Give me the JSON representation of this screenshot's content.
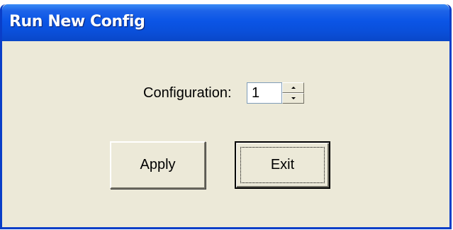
{
  "window": {
    "title": "Run New Config"
  },
  "form": {
    "configuration_label": "Configuration:",
    "configuration_value": "1"
  },
  "buttons": {
    "apply_label": "Apply",
    "exit_label": "Exit"
  },
  "icons": {
    "spin_up": "spin-up-arrow-icon",
    "spin_down": "spin-down-arrow-icon"
  },
  "colors": {
    "titlebar": "#0b55e6",
    "window_bg": "#ece9d8",
    "title_text": "#ffffff"
  }
}
